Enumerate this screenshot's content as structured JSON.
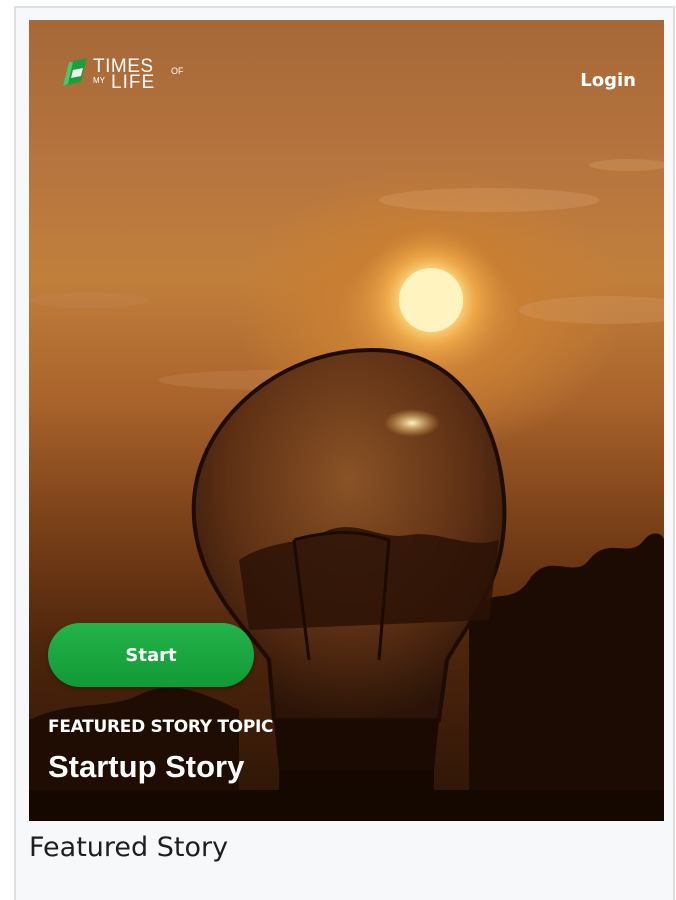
{
  "header": {
    "logo": {
      "line1": "TIMES",
      "of": "OF",
      "my": "MY",
      "line2": "LIFE",
      "colors": {
        "leaf": "#1e9d3f",
        "text": "#ffffff"
      }
    },
    "login_label": "Login"
  },
  "hero": {
    "start_label": "Start",
    "topic_label": "FEATURED STORY TOPIC",
    "topic_title": "Startup Story",
    "image_description_icon": "lightbulb-sunset-photo"
  },
  "caption": "Featured Story",
  "colors": {
    "start_button": "#18a23c",
    "card_background": "#f7f8f9",
    "card_border": "#dedfe1"
  }
}
